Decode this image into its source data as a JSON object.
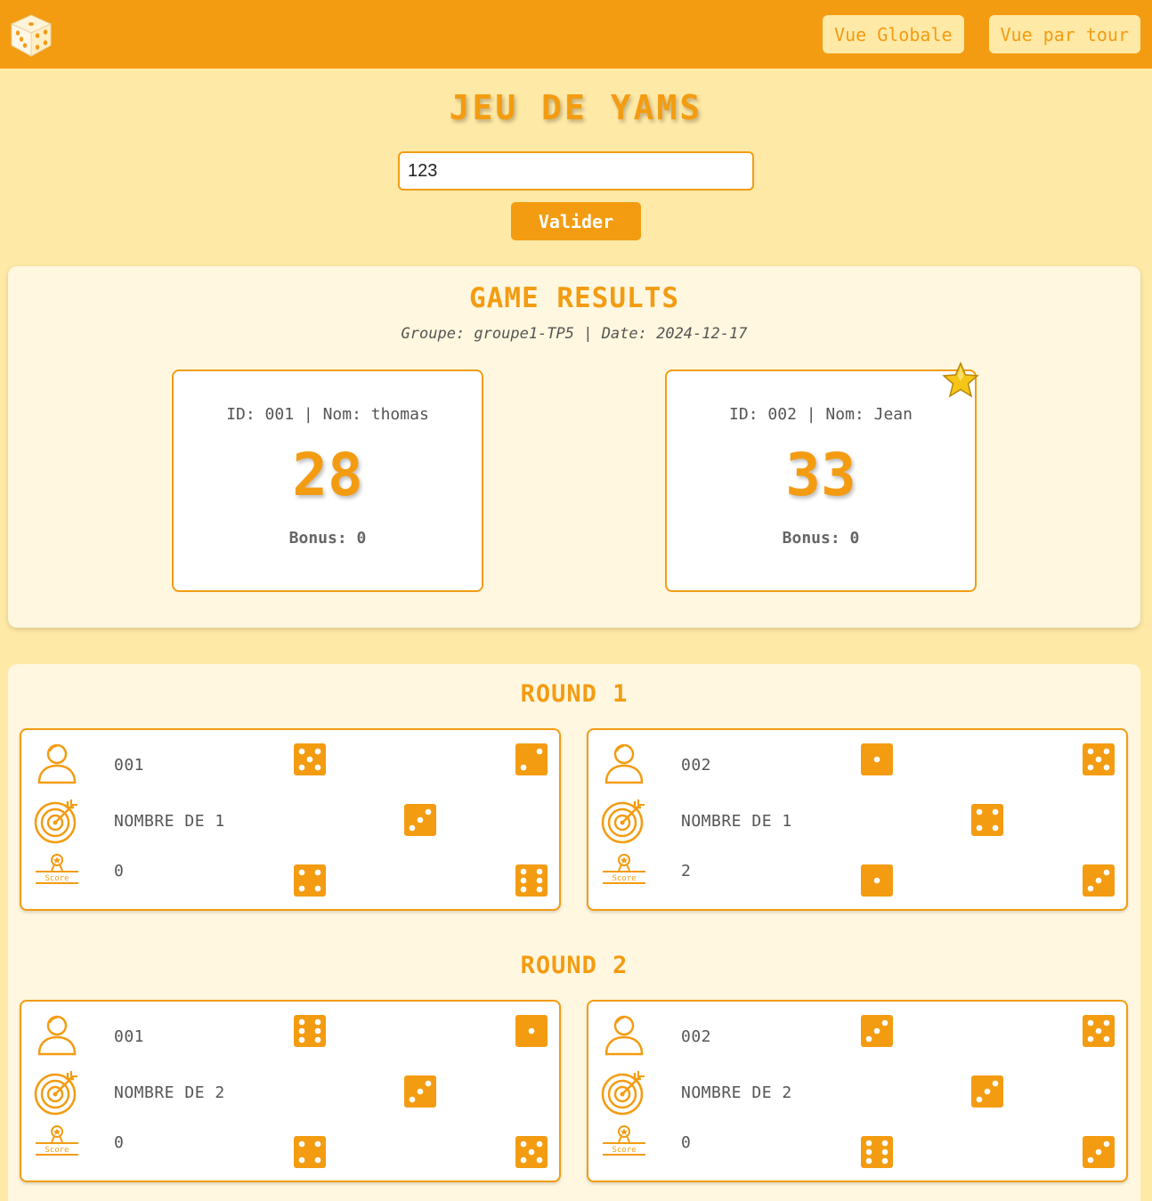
{
  "nav": {
    "global_label": "Vue Globale",
    "round_label": "Vue par tour"
  },
  "page": {
    "title": "JEU DE YAMS"
  },
  "form": {
    "input_value": "123",
    "submit_label": "Valider"
  },
  "results": {
    "title": "GAME RESULTS",
    "meta": "Groupe: groupe1-TP5 | Date: 2024-12-17",
    "players": [
      {
        "label": "ID: 001 | Nom: thomas",
        "score": "28",
        "bonus": "Bonus: 0",
        "winner": false
      },
      {
        "label": "ID: 002 | Nom: Jean",
        "score": "33",
        "bonus": "Bonus: 0",
        "winner": true
      }
    ]
  },
  "rounds": [
    {
      "title": "ROUND 1",
      "turns": [
        {
          "player": "001",
          "challenge": "NOMBRE DE 1",
          "score": "0",
          "dice": [
            5,
            2,
            3,
            4,
            6
          ]
        },
        {
          "player": "002",
          "challenge": "NOMBRE DE 1",
          "score": "2",
          "dice": [
            1,
            5,
            4,
            1,
            3
          ]
        }
      ]
    },
    {
      "title": "ROUND 2",
      "turns": [
        {
          "player": "001",
          "challenge": "NOMBRE DE 2",
          "score": "0",
          "dice": [
            6,
            1,
            3,
            4,
            5
          ]
        },
        {
          "player": "002",
          "challenge": "NOMBRE DE 2",
          "score": "0",
          "dice": [
            3,
            5,
            3,
            6,
            3
          ]
        }
      ]
    }
  ],
  "colors": {
    "accent": "#f39c12",
    "background": "#ffe9a6",
    "panel": "#fff7df"
  },
  "icons": {
    "logo": "dice-logo-icon",
    "player": "user-icon",
    "challenge": "target-icon",
    "score": "score-badge-icon",
    "winner": "star-icon"
  }
}
